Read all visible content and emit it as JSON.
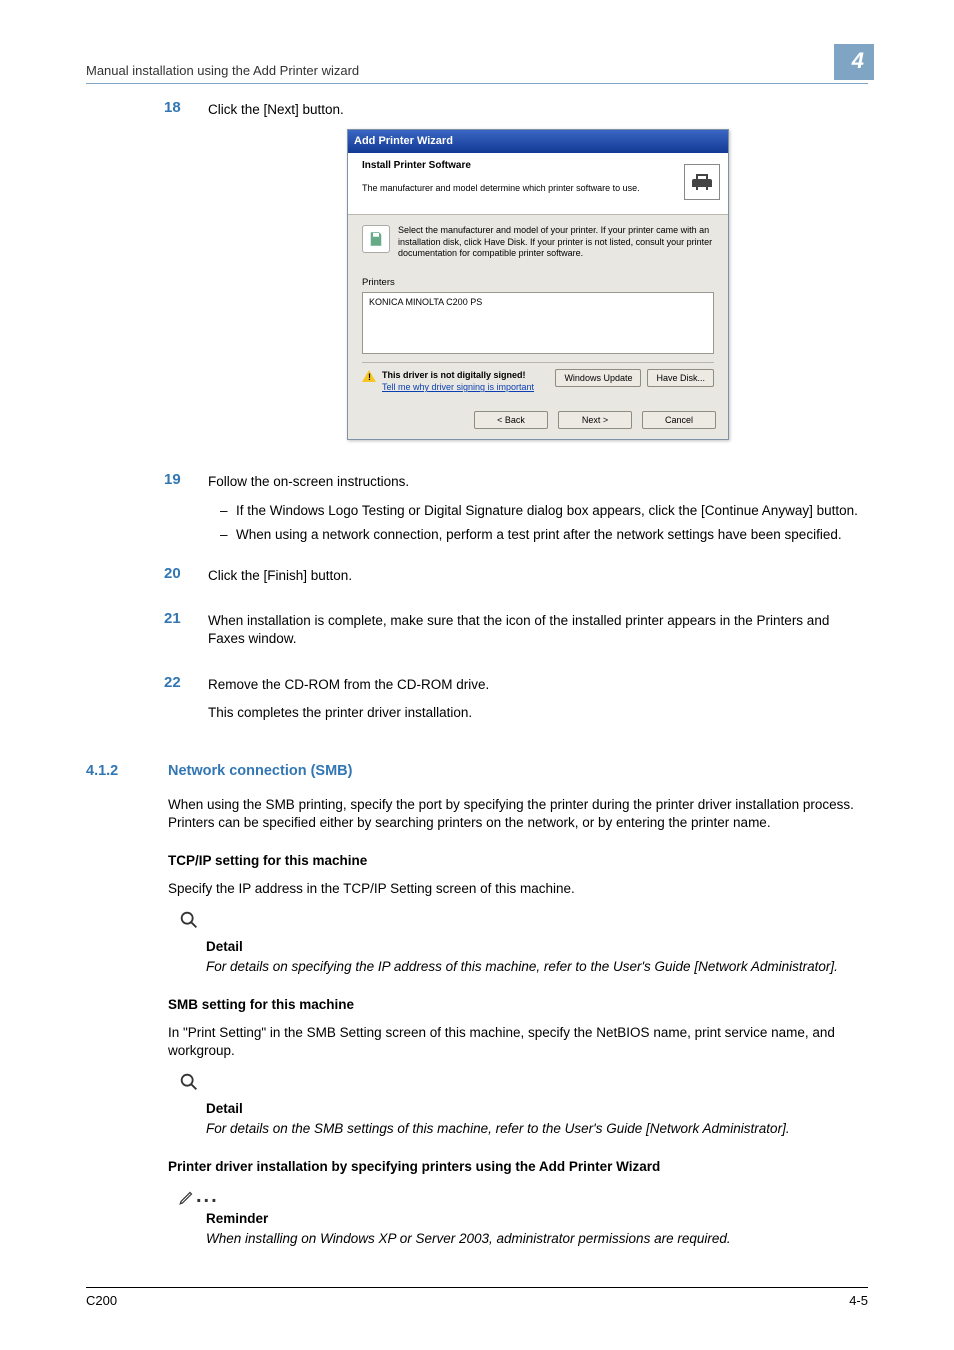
{
  "header": {
    "title": "Manual installation using the Add Printer wizard",
    "chapter_number": "4"
  },
  "steps": {
    "s18": {
      "num": "18",
      "text": "Click the [Next] button."
    },
    "s19": {
      "num": "19",
      "text": "Follow the on-screen instructions.",
      "b1": "If the Windows Logo Testing or Digital Signature dialog box appears, click the [Continue Anyway] button.",
      "b2": "When using a network connection, perform a test print after the network settings have been specified."
    },
    "s20": {
      "num": "20",
      "text": "Click the [Finish] button."
    },
    "s21": {
      "num": "21",
      "text": "When installation is complete, make sure that the icon of the installed printer appears in the Printers and Faxes window."
    },
    "s22": {
      "num": "22",
      "text": "Remove the CD-ROM from the CD-ROM drive."
    },
    "s22_after": "This completes the printer driver installation."
  },
  "section": {
    "num": "4.1.2",
    "title": "Network connection (SMB)",
    "intro": "When using the SMB printing, specify the port by specifying the printer during the printer driver installation process. Printers can be specified either by searching printers on the network, or by entering the printer name."
  },
  "tcpip": {
    "heading": "TCP/IP setting for this machine",
    "body": "Specify the IP address in the TCP/IP Setting screen of this machine.",
    "detail_title": "Detail",
    "detail_body": "For details on specifying the IP address of this machine, refer to the User's Guide [Network Administrator]."
  },
  "smb": {
    "heading": "SMB setting for this machine",
    "body": "In \"Print Setting\" in the SMB Setting screen of this machine, specify the NetBIOS name, print service name, and workgroup.",
    "detail_title": "Detail",
    "detail_body": "For details on the SMB settings of this machine, refer to the User's Guide [Network Administrator]."
  },
  "driver": {
    "heading": "Printer driver installation by specifying printers using the Add Printer Wizard",
    "reminder_title": "Reminder",
    "reminder_body": "When installing on Windows XP or Server 2003, administrator permissions are required."
  },
  "footer": {
    "left": "C200",
    "right": "4-5"
  },
  "wizard": {
    "title": "Add Printer Wizard",
    "header_title": "Install Printer Software",
    "header_sub": "The manufacturer and model determine which printer software to use.",
    "info": "Select the manufacturer and model of your printer. If your printer came with an installation disk, click Have Disk. If your printer is not listed, consult your printer documentation for compatible printer software.",
    "list_label": "Printers",
    "list_item": "KONICA MINOLTA C200 PS",
    "warn_bold": "This driver is not digitally signed!",
    "warn_link": "Tell me why driver signing is important",
    "btn_win_update": "Windows Update",
    "btn_have_disk": "Have Disk...",
    "btn_back": "< Back",
    "btn_next": "Next >",
    "btn_cancel": "Cancel"
  }
}
